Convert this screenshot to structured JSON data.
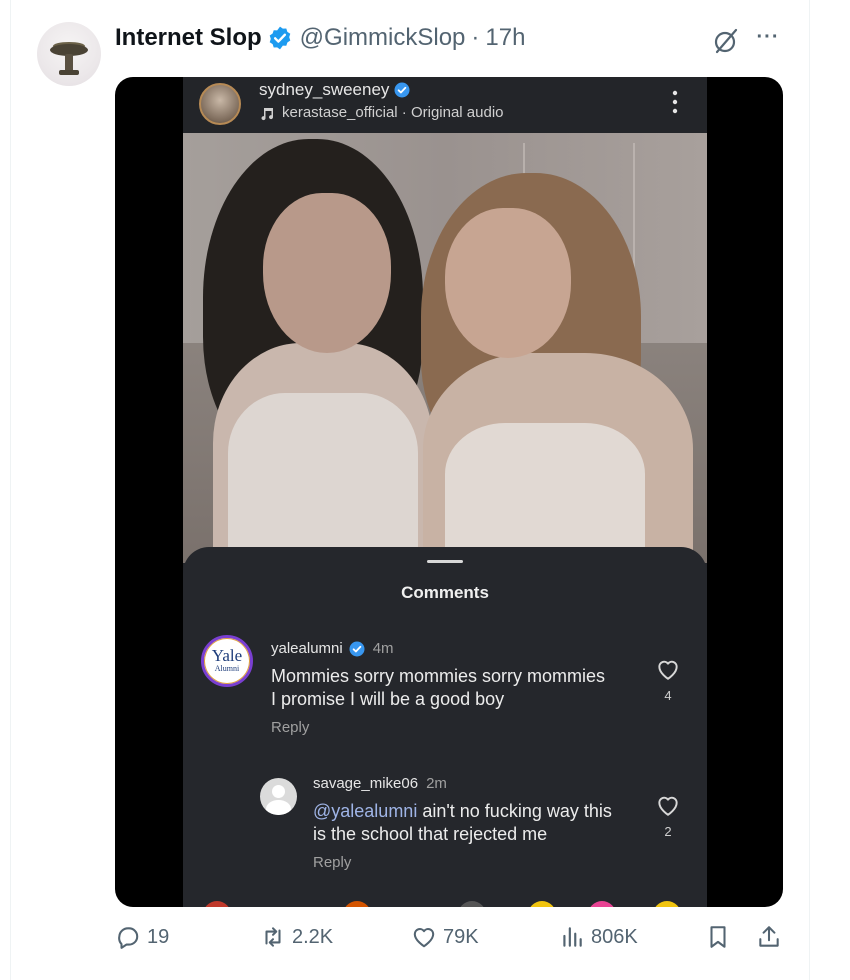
{
  "tweet": {
    "author_name": "Internet Slop",
    "handle": "@GimmickSlop",
    "separator": "·",
    "time": "17h"
  },
  "instagram": {
    "username": "sydney_sweeney",
    "audio": "kerastase_official · Original audio",
    "comments_title": "Comments",
    "comments": [
      {
        "username": "yalealumni",
        "time": "4m",
        "avatar_word": "Yale",
        "avatar_sub": "Alumni",
        "text_line1": "Mommies sorry mommies sorry mommies",
        "text_line2": "I promise I will be a good boy",
        "reply": "Reply",
        "likes": "4"
      },
      {
        "username": "savage_mike06",
        "time": "2m",
        "mention": "@yalealumni",
        "text_line1_rest": " ain't no fucking way this",
        "text_line2": "is the school that rejected me",
        "reply": "Reply",
        "likes": "2"
      }
    ]
  },
  "actions": {
    "replies": "19",
    "reposts": "2.2K",
    "likes": "79K",
    "views": "806K"
  },
  "colors": {
    "verified_blue": "#1d9bf0",
    "muted_text": "#536471",
    "sheet_bg": "#25272c"
  }
}
